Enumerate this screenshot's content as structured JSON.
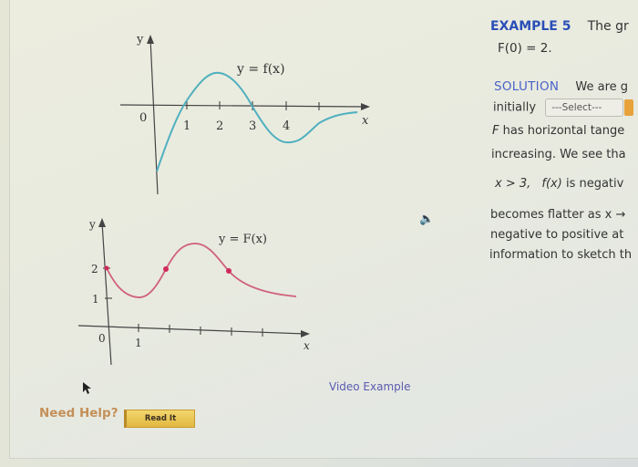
{
  "graphs": {
    "f": {
      "label": "y = f(x)",
      "y_axis_label": "y",
      "x_axis_label": "x",
      "origin_label": "0",
      "x_tick_labels": [
        "1",
        "2",
        "3",
        "4"
      ],
      "color": "#4fb0bf"
    },
    "F": {
      "label": "y = F(x)",
      "y_axis_label": "y",
      "x_axis_label": "x",
      "origin_label": "0",
      "x_tick_labels": [
        "1"
      ],
      "y_tick_labels": [
        "1",
        "2"
      ],
      "color": "#d0607a",
      "marked_point_color": "#d02a5c"
    }
  },
  "example": {
    "label": "EXAMPLE 5",
    "text_start": "The gr",
    "condition": "F(0) = 2."
  },
  "solution": {
    "label": "SOLUTION",
    "line1": "We are g",
    "line2_prefix": "initially",
    "select_value": "---Select---",
    "line3_F": "F",
    "line3_rest": " has horizontal tange",
    "line4": "increasing. We see tha",
    "line5_cond": "x > 3,",
    "line5_fx": "f(x)",
    "line5_rest": " is negativ",
    "line6": "becomes flatter as  x →",
    "line7": "negative to positive at",
    "line8": "information to sketch th"
  },
  "icons": {
    "speaker": "speaker-icon"
  },
  "video_example": "Video Example",
  "help": {
    "label": "Need Help?",
    "read_it": "Read It"
  }
}
